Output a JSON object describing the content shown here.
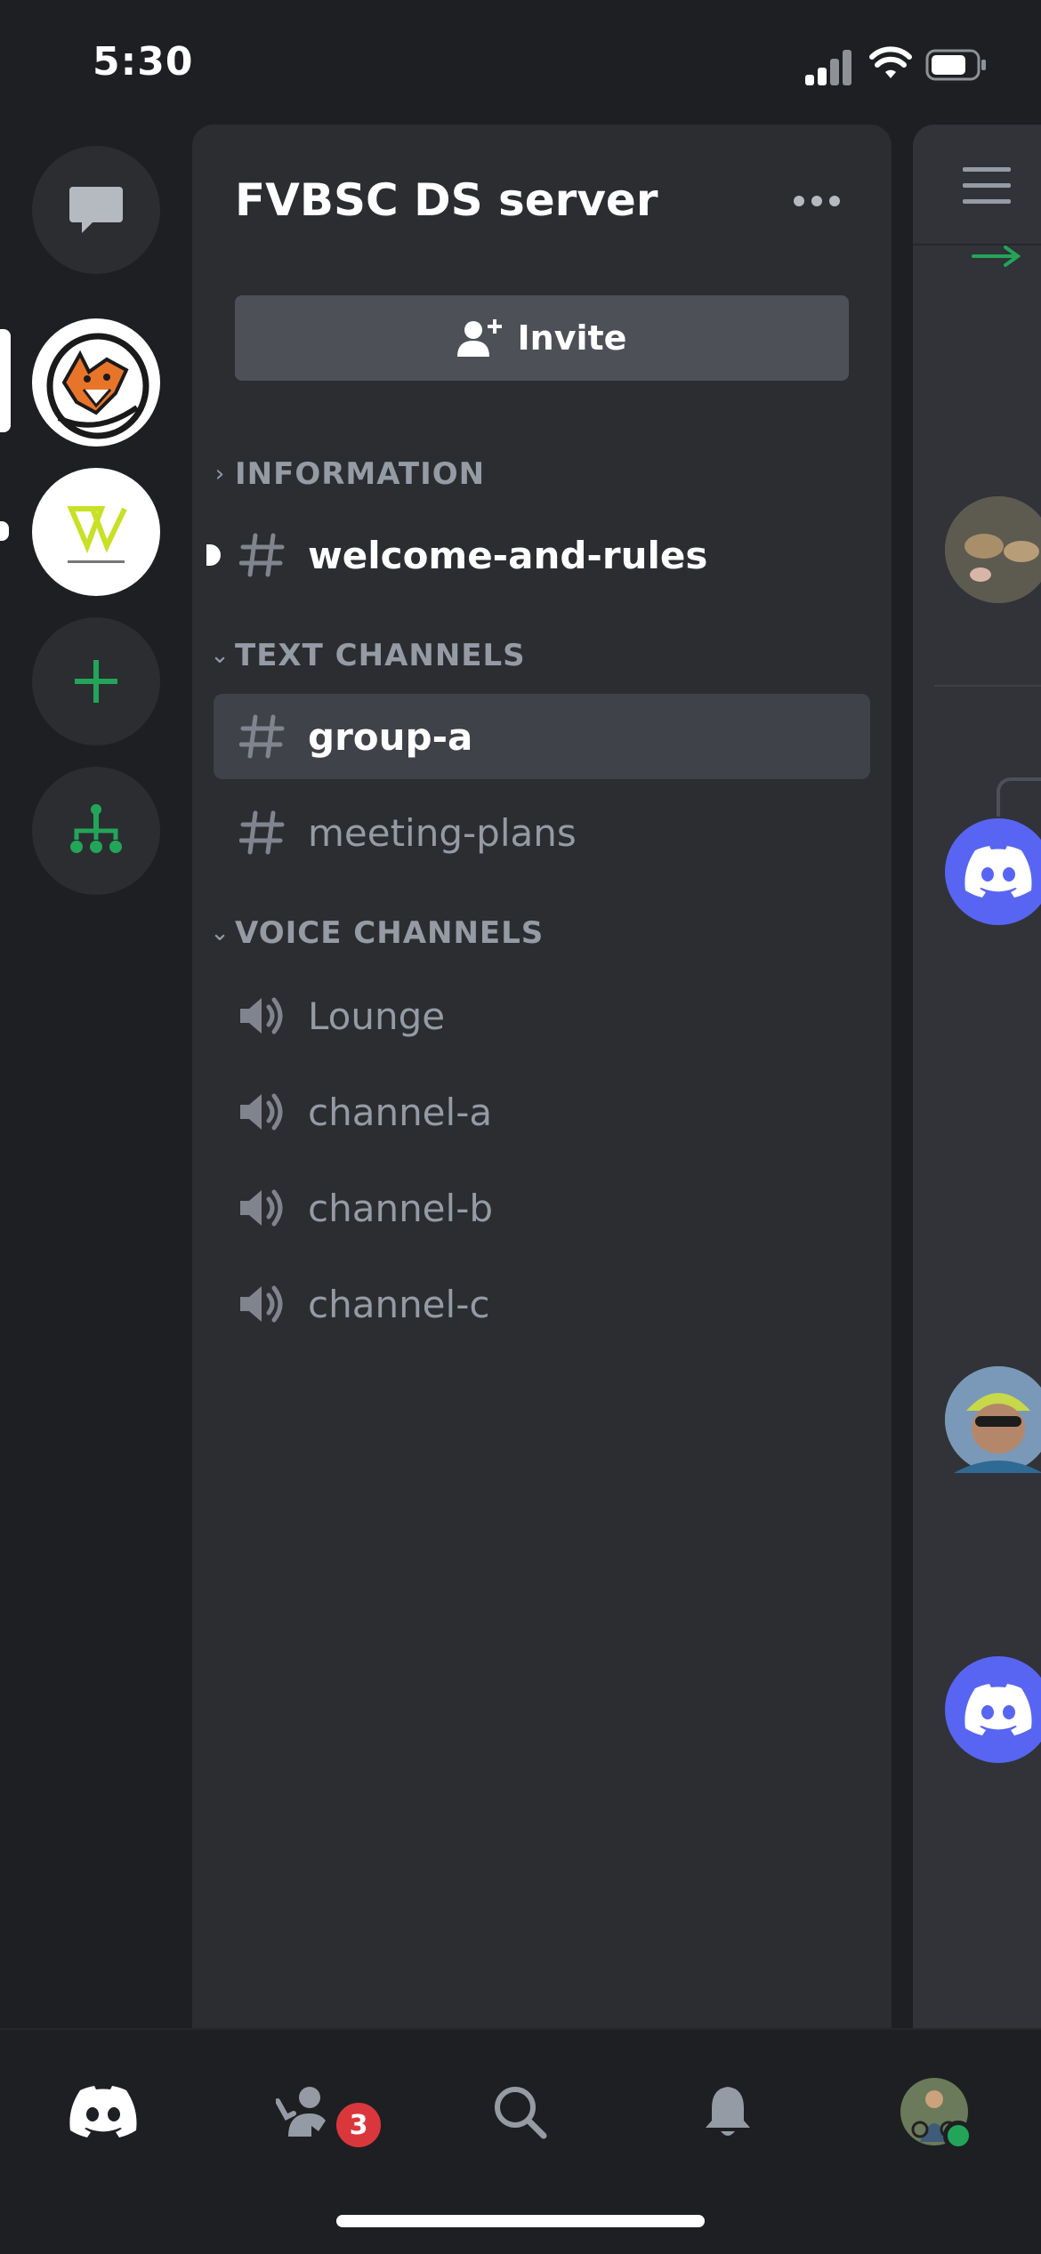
{
  "status_bar": {
    "time": "5:30"
  },
  "server": {
    "name": "FVBSC DS server",
    "invite_label": "Invite"
  },
  "categories": [
    {
      "label": "INFORMATION",
      "chevron": "›",
      "collapsed": true
    },
    {
      "label": "TEXT CHANNELS",
      "chevron": "⌄",
      "collapsed": false
    },
    {
      "label": "VOICE CHANNELS",
      "chevron": "⌄",
      "collapsed": false
    }
  ],
  "info_channels": [
    {
      "name": "welcome-and-rules",
      "icon": "hash-icon",
      "unread": true
    }
  ],
  "text_channels": [
    {
      "name": "group-a",
      "icon": "hash-icon",
      "selected": true
    },
    {
      "name": "meeting-plans",
      "icon": "hash-icon",
      "selected": false
    }
  ],
  "voice_channels": [
    {
      "name": "Lounge",
      "icon": "speaker-icon"
    },
    {
      "name": "channel-a",
      "icon": "speaker-icon"
    },
    {
      "name": "channel-b",
      "icon": "speaker-icon"
    },
    {
      "name": "channel-c",
      "icon": "speaker-icon"
    }
  ],
  "bottom_nav": {
    "friends_badge": "3"
  },
  "colors": {
    "background": "#1e1f22",
    "panel": "#2b2d31",
    "selected": "#404249",
    "blurple": "#5865f2",
    "green": "#23a559",
    "badge_red": "#da373c",
    "muted_text": "#949ba4"
  }
}
